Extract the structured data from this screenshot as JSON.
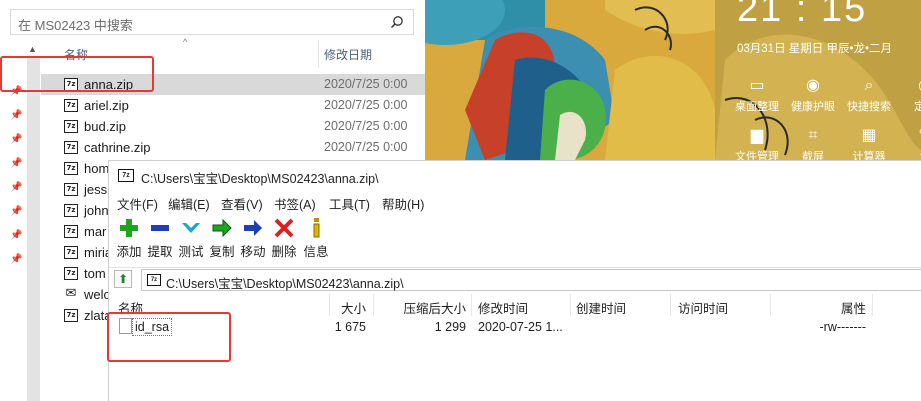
{
  "explorer": {
    "search_placeholder": "在 MS02423 中搜索",
    "col_name": "名称",
    "col_modified": "修改日期",
    "files": [
      {
        "name": "anna.zip",
        "date": "2020/7/25 0:00",
        "icon": "7z"
      },
      {
        "name": "ariel.zip",
        "date": "2020/7/25 0:00",
        "icon": "7z"
      },
      {
        "name": "bud.zip",
        "date": "2020/7/25 0:00",
        "icon": "7z"
      },
      {
        "name": "cathrine.zip",
        "date": "2020/7/25 0:00",
        "icon": "7z"
      },
      {
        "name": "hom",
        "date": "",
        "icon": "7z"
      },
      {
        "name": "jessi",
        "date": "",
        "icon": "7z"
      },
      {
        "name": "john",
        "date": "",
        "icon": "7z"
      },
      {
        "name": "mar",
        "date": "",
        "icon": "7z"
      },
      {
        "name": "miria",
        "date": "",
        "icon": "7z"
      },
      {
        "name": "tom",
        "date": "",
        "icon": "7z"
      },
      {
        "name": "welc",
        "date": "",
        "icon": "mail"
      },
      {
        "name": "zlata",
        "date": "",
        "icon": "7z"
      }
    ]
  },
  "widget": {
    "clock": "21 : 15",
    "date": "03月31日   星期日   甲辰•龙•二月",
    "tools": [
      {
        "label": "桌面整理",
        "icon": "monitor-icon",
        "glyph": "▭"
      },
      {
        "label": "健康护眼",
        "icon": "eye-icon",
        "glyph": "◉"
      },
      {
        "label": "快捷搜索",
        "icon": "search-icon",
        "glyph": "⌕"
      },
      {
        "label": "定时",
        "icon": "clock-icon",
        "glyph": "◷"
      }
    ],
    "tools2": [
      {
        "label": "文件管理",
        "icon": "folder-icon",
        "glyph": "▆"
      },
      {
        "label": "截屏",
        "icon": "crop-icon",
        "glyph": "⌗"
      },
      {
        "label": "计算器",
        "icon": "calculator-icon",
        "glyph": "▦"
      },
      {
        "label": "记",
        "icon": "note-icon",
        "glyph": "✎"
      }
    ]
  },
  "sevenzip": {
    "title": "C:\\Users\\宝宝\\Desktop\\MS02423\\anna.zip\\",
    "menu": [
      "文件(F)",
      "编辑(E)",
      "查看(V)",
      "书签(A)",
      "工具(T)",
      "帮助(H)"
    ],
    "toolbar": [
      {
        "label": "添加",
        "icon": "add-icon",
        "color": "#1ea51e"
      },
      {
        "label": "提取",
        "icon": "extract-icon",
        "color": "#1f3fb8"
      },
      {
        "label": "测试",
        "icon": "test-icon",
        "color": "#17a7c9"
      },
      {
        "label": "复制",
        "icon": "copy-icon",
        "color": "#1ea51e"
      },
      {
        "label": "移动",
        "icon": "move-icon",
        "color": "#1f3fb8"
      },
      {
        "label": "删除",
        "icon": "delete-icon",
        "color": "#e02020"
      },
      {
        "label": "信息",
        "icon": "info-icon",
        "color": "#d8b800"
      }
    ],
    "address": "C:\\Users\\宝宝\\Desktop\\MS02423\\anna.zip\\",
    "columns": [
      "名称",
      "大小",
      "压缩后大小",
      "修改时间",
      "创建时间",
      "访问时间",
      "属性"
    ],
    "row": {
      "name": "id_rsa",
      "size": "1 675",
      "packed": "1 299",
      "modified": "2020-07-25 1...",
      "created": "",
      "accessed": "",
      "attr": "-rw-------"
    }
  }
}
